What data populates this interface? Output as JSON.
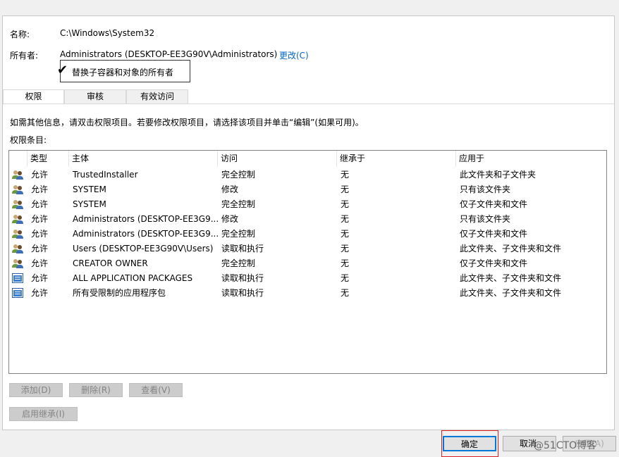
{
  "name_label": "名称:",
  "name_value": "C:\\Windows\\System32",
  "owner_label": "所有者:",
  "owner_value": "Administrators (DESKTOP-EE3G90V\\Administrators)",
  "change_link": "更改(C)",
  "replace_owner_checkbox": {
    "label": "替换子容器和对象的所有者",
    "checked": true
  },
  "tabs": [
    {
      "label": "权限",
      "active": true
    },
    {
      "label": "审核"
    },
    {
      "label": "有效访问"
    }
  ],
  "info_text": "如需其他信息，请双击权限项目。若要修改权限项目，请选择该项目并单击“编辑”(如果可用)。",
  "entries_label": "权限条目:",
  "columns": [
    "类型",
    "主体",
    "访问",
    "继承于",
    "应用于"
  ],
  "rows": [
    {
      "icon": "users-icon",
      "type": "允许",
      "principal": "TrustedInstaller",
      "access": "完全控制",
      "inherited": "无",
      "applies": "此文件夹和子文件夹"
    },
    {
      "icon": "users-icon",
      "type": "允许",
      "principal": "SYSTEM",
      "access": "修改",
      "inherited": "无",
      "applies": "只有该文件夹"
    },
    {
      "icon": "users-icon",
      "type": "允许",
      "principal": "SYSTEM",
      "access": "完全控制",
      "inherited": "无",
      "applies": "仅子文件夹和文件"
    },
    {
      "icon": "users-icon",
      "type": "允许",
      "principal": "Administrators (DESKTOP-EE3G9...",
      "access": "修改",
      "inherited": "无",
      "applies": "只有该文件夹"
    },
    {
      "icon": "users-icon",
      "type": "允许",
      "principal": "Administrators (DESKTOP-EE3G9...",
      "access": "完全控制",
      "inherited": "无",
      "applies": "仅子文件夹和文件"
    },
    {
      "icon": "users-icon",
      "type": "允许",
      "principal": "Users (DESKTOP-EE3G90V\\Users)",
      "access": "读取和执行",
      "inherited": "无",
      "applies": "此文件夹、子文件夹和文件"
    },
    {
      "icon": "users-icon",
      "type": "允许",
      "principal": "CREATOR OWNER",
      "access": "完全控制",
      "inherited": "无",
      "applies": "仅子文件夹和文件"
    },
    {
      "icon": "app-package-icon",
      "type": "允许",
      "principal": "ALL APPLICATION PACKAGES",
      "access": "读取和执行",
      "inherited": "无",
      "applies": "此文件夹、子文件夹和文件"
    },
    {
      "icon": "app-package-icon",
      "type": "允许",
      "principal": "所有受限制的应用程序包",
      "access": "读取和执行",
      "inherited": "无",
      "applies": "此文件夹、子文件夹和文件"
    }
  ],
  "buttons": {
    "add": "添加(D)",
    "remove": "删除(R)",
    "view": "查看(V)",
    "enable_inheritance": "启用继承(I)",
    "ok": "确定",
    "cancel": "取消",
    "apply": "应用(A)"
  },
  "watermark": "@51CTO博客",
  "colors": {
    "link": "#0066cc",
    "highlight": "#e02020",
    "focus": "#0078d7"
  }
}
